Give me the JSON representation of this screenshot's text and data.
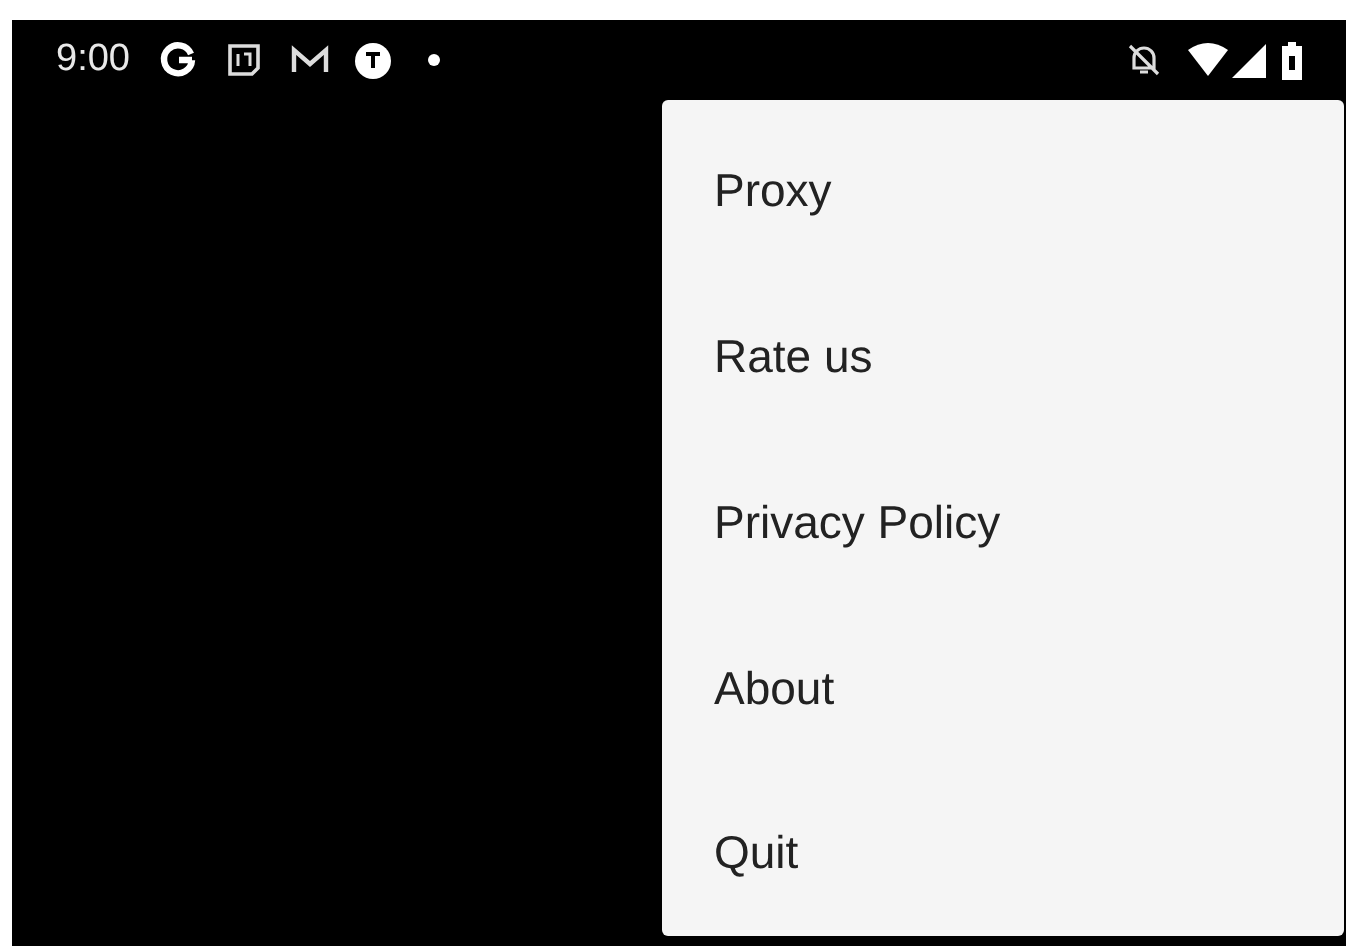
{
  "status_bar": {
    "time": "9:00"
  },
  "menu": {
    "items": [
      {
        "label": "Proxy"
      },
      {
        "label": "Rate us"
      },
      {
        "label": "Privacy Policy"
      },
      {
        "label": "About"
      },
      {
        "label": "Quit"
      }
    ]
  }
}
